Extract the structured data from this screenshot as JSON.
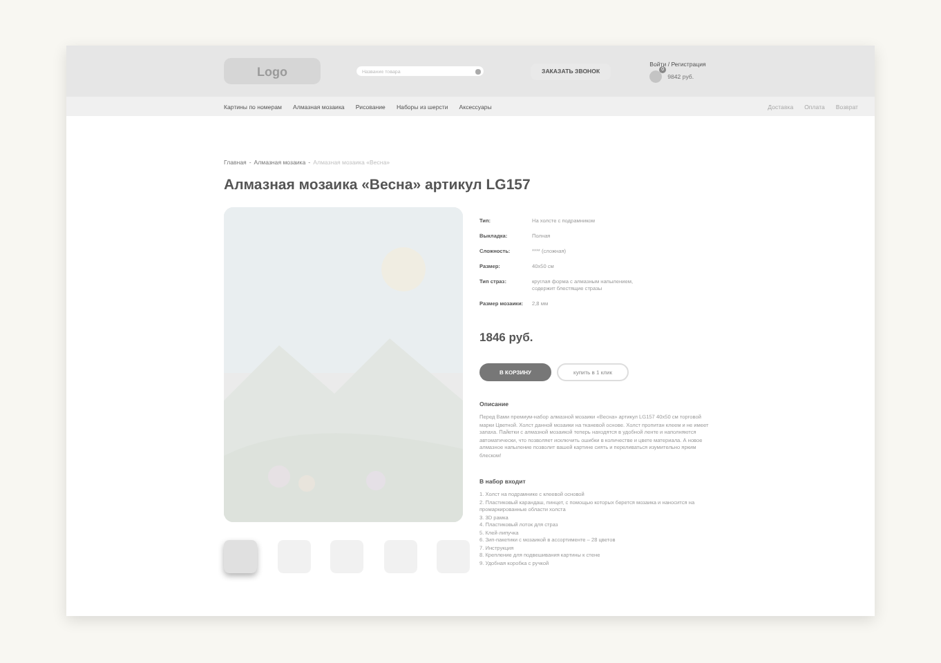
{
  "header": {
    "logo": "Logo",
    "search": {
      "placeholder": "Название товара"
    },
    "callback_button": "ЗАКАЗАТЬ ЗВОНОК",
    "login": "Войти / Регистрация",
    "cart": {
      "badge": "0",
      "total": "9842 руб."
    }
  },
  "nav": {
    "categories": [
      "Картины по номерам",
      "Алмазная мозаика",
      "Рисование",
      "Наборы из шерсти",
      "Аксессуары"
    ],
    "info_links": [
      "Доставка",
      "Оплата",
      "Возврат"
    ]
  },
  "breadcrumbs": {
    "separator": "-",
    "items": [
      {
        "label": "Главная",
        "current": false
      },
      {
        "label": "Алмазная мозаика",
        "current": false
      },
      {
        "label": "Алмазная мозаика «Весна»",
        "current": true
      }
    ]
  },
  "title": "Алмазная мозаика «Весна» артикул LG157",
  "gallery": {
    "thumbnails": [
      {
        "selected": true
      },
      {
        "selected": false
      },
      {
        "selected": false
      },
      {
        "selected": false
      },
      {
        "selected": false
      }
    ]
  },
  "specs": [
    {
      "label": "Тип:",
      "value": "На холсте с подрамником"
    },
    {
      "label": "Выкладка:",
      "value": "Полная"
    },
    {
      "label": "Сложность:",
      "value": "**** (сложная)"
    },
    {
      "label": "Размер:",
      "value": "40x50 см"
    },
    {
      "label": "Тип страз:",
      "value": "круглая форма с алмазным напылением, содержит блестящие стразы"
    },
    {
      "label": "Размер мозаики:",
      "value": "2,8 мм"
    }
  ],
  "price": "1846 руб.",
  "buttons": {
    "cart": "В КОРЗИНУ",
    "one_click": "купить в 1 клик"
  },
  "description": {
    "heading": "Описание",
    "text": "Перед Вами премиум-набор алмазной мозаики «Весна» артикул LG157 40x50 см торговой марки Цветной. Холст данной мозаики на тканевой основе. Холст пропитан клеем и не имеет запаха. Пайетки с алмазной мозаикой теперь находятся в удобной ленте и наполняются автоматически, что позволяет исключить ошибки в количестве и цвете материала. А новое алмазное напыление позволит вашей картине сиять и переливаться изумительно ярким блеском!"
  },
  "kit": {
    "heading": "В набор входит",
    "items": [
      "1. Холст на подрамнике с клеевой основой",
      "2. Пластиковый карандаш, пинцет, с помощью которых берется мозаика и наносится на промаркированные области холста",
      "3. 3D рамка",
      "4. Пластиковый лоток для страз",
      "5. Клей-липучка",
      "6. Зип-пакетики с мозаикой в ассортименте – 28 цветов",
      "7. Инструкция",
      "8. Крепление для подвешивания картины к стене",
      "9. Удобная коробка с ручкой"
    ]
  }
}
